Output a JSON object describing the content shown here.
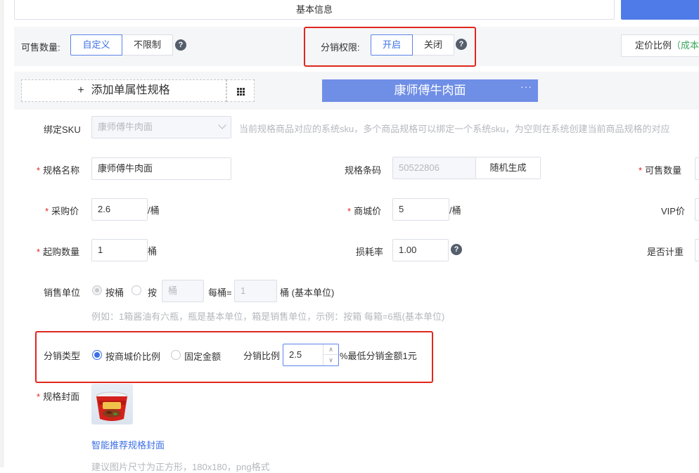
{
  "header": {
    "basic_info_tab": "基本信息"
  },
  "toolbar": {
    "saleable_qty_label": "可售数量:",
    "saleable_options": [
      "自定义",
      "不限制"
    ],
    "distribution_perm_label": "分销权限:",
    "distribution_options": [
      "开启",
      "关闭"
    ],
    "pricing_ratio_btn": "定价比例",
    "pricing_ratio_suffix": "（成本"
  },
  "spec": {
    "add_single_spec": "添加单属性规格",
    "active_spec_tab": "康师傅牛肉面",
    "tab_more": "···"
  },
  "form": {
    "bind_sku_label": "绑定SKU",
    "bind_sku_value": "康师傅牛肉面",
    "bind_sku_hint": "当前规格商品对应的系统sku，多个商品规格可以绑定一个系统sku，为空则在系统创建当前商品规格的对应",
    "spec_name_label": "规格名称",
    "spec_name_value": "康师傅牛肉面",
    "barcode_label": "规格条码",
    "barcode_value": "50522806",
    "random_gen_btn": "随机生成",
    "saleable_qty_label": "可售数量",
    "purchase_price_label": "采购价",
    "purchase_price_value": "2.6",
    "purchase_price_unit": "/桶",
    "mall_price_label": "商城价",
    "mall_price_value": "5",
    "mall_price_unit": "/桶",
    "vip_price_label": "VIP价",
    "min_purchase_label": "起购数量",
    "min_purchase_value": "1",
    "min_purchase_unit": "桶",
    "loss_rate_label": "损耗率",
    "loss_rate_value": "1.00",
    "weighing_label": "是否计重",
    "sale_unit_label": "销售单位",
    "sale_unit_opt1": "按桶",
    "sale_unit_opt2": "按",
    "sale_unit_input": "桶",
    "per_bucket_label": "每桶=",
    "per_bucket_value": "1",
    "base_unit_text": "桶 (基本单位)",
    "sale_unit_hint": "例如：1箱酱油有六瓶，瓶是基本单位，箱是销售单位，示例：按箱 每箱=6瓶(基本单位)",
    "dist_type_label": "分销类型",
    "dist_type_opt1": "按商城价比例",
    "dist_type_opt2": "固定金额",
    "dist_ratio_label": "分销比例",
    "dist_ratio_value": "2.5",
    "dist_ratio_suffix": "%最低分销金额1元",
    "cover_label": "规格封面",
    "smart_cover_link": "智能推荐规格封面",
    "cover_hint": "建议图片尺寸为正方形，180x180，png格式"
  },
  "colors": {
    "accent": "#3c6fe5",
    "highlight_box": "#e0271e",
    "spec_tab": "#6f8ee6"
  }
}
